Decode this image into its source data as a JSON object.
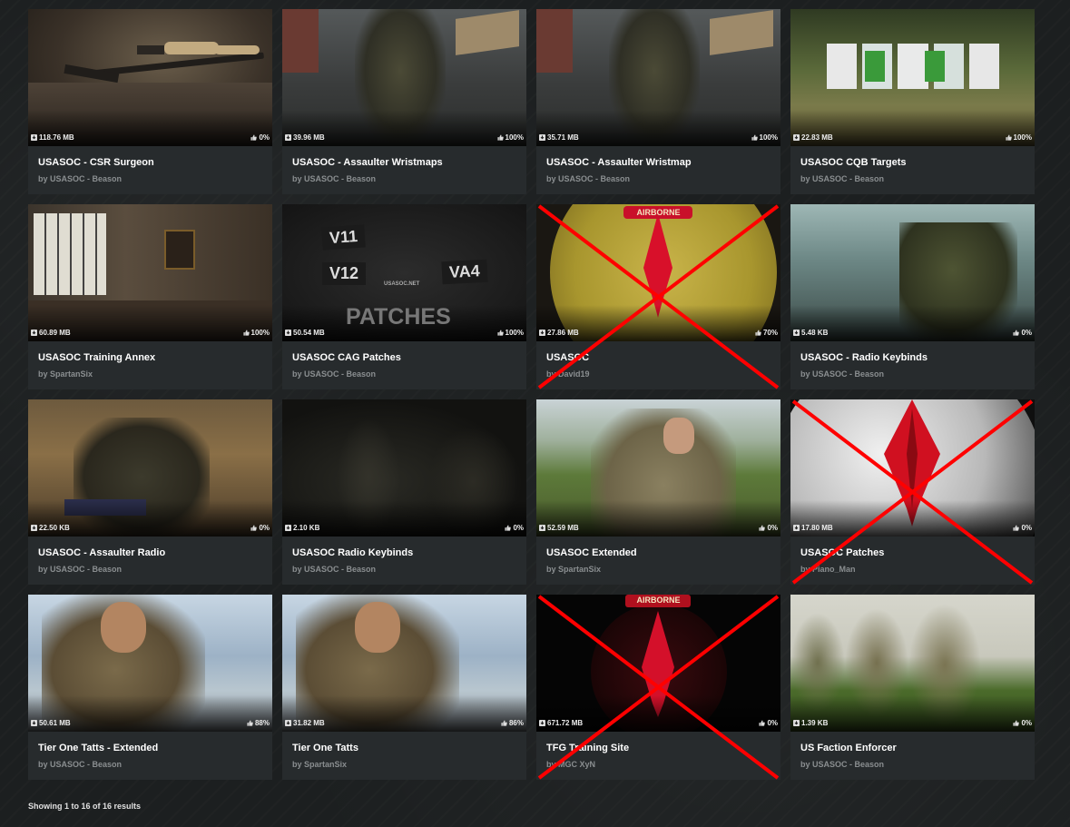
{
  "items": [
    {
      "title": "USASOC - CSR Surgeon",
      "author": "by USASOC - Beason",
      "size": "118.76 MB",
      "rating": "0%",
      "crossed": false,
      "scene": "rifle"
    },
    {
      "title": "USASOC - Assaulter Wristmaps",
      "author": "by USASOC - Beason",
      "size": "39.96 MB",
      "rating": "100%",
      "crossed": false,
      "scene": "hangar"
    },
    {
      "title": "USASOC - Assaulter Wristmap",
      "author": "by USASOC - Beason",
      "size": "35.71 MB",
      "rating": "100%",
      "crossed": false,
      "scene": "hangar"
    },
    {
      "title": "USASOC CQB Targets",
      "author": "by USASOC - Beason",
      "size": "22.83 MB",
      "rating": "100%",
      "crossed": false,
      "scene": "targets"
    },
    {
      "title": "USASOC Training Annex",
      "author": "by SpartanSix",
      "size": "60.89 MB",
      "rating": "100%",
      "crossed": false,
      "scene": "room"
    },
    {
      "title": "USASOC CAG Patches",
      "author": "by USASOC - Beason",
      "size": "50.54 MB",
      "rating": "100%",
      "crossed": false,
      "scene": "patches"
    },
    {
      "title": "USASOC",
      "author": "by David19",
      "size": "27.86 MB",
      "rating": "70%",
      "crossed": true,
      "scene": "emblem"
    },
    {
      "title": "USASOC - Radio Keybinds",
      "author": "by USASOC - Beason",
      "size": "5.48 KB",
      "rating": "0%",
      "crossed": false,
      "scene": "radio"
    },
    {
      "title": "USASOC - Assaulter Radio",
      "author": "by USASOC - Beason",
      "size": "22.50 KB",
      "rating": "0%",
      "crossed": false,
      "scene": "field"
    },
    {
      "title": "USASOC Radio Keybinds",
      "author": "by USASOC - Beason",
      "size": "2.10 KB",
      "rating": "0%",
      "crossed": false,
      "scene": "dark"
    },
    {
      "title": "USASOC Extended",
      "author": "by SpartanSix",
      "size": "52.59 MB",
      "rating": "0%",
      "crossed": false,
      "scene": "soldier"
    },
    {
      "title": "USASOC Patches",
      "author": "by Piano_Man",
      "size": "17.80 MB",
      "rating": "0%",
      "crossed": true,
      "scene": "globe"
    },
    {
      "title": "Tier One Tatts - Extended",
      "author": "by USASOC - Beason",
      "size": "50.61 MB",
      "rating": "88%",
      "crossed": false,
      "scene": "sky"
    },
    {
      "title": "Tier One Tatts",
      "author": "by SpartanSix",
      "size": "31.82 MB",
      "rating": "86%",
      "crossed": false,
      "scene": "sky"
    },
    {
      "title": "TFG Training Site",
      "author": "by MGC XyN",
      "size": "671.72 MB",
      "rating": "0%",
      "crossed": true,
      "scene": "airborne"
    },
    {
      "title": "US Faction Enforcer",
      "author": "by USASOC - Beason",
      "size": "1.39 KB",
      "rating": "0%",
      "crossed": false,
      "scene": "squad"
    }
  ],
  "patch_labels": {
    "v11": "V11",
    "v12": "V12",
    "va4": "VA4",
    "site": "USASOC.NET",
    "patches": "PATCHES"
  },
  "airborne_label": "AIRBORNE",
  "status": "Showing 1 to 16 of 16 results",
  "colors": {
    "background": "#1c1f20",
    "card": "#272b2d",
    "title": "#ffffff",
    "author": "#8a8e90",
    "cross": "#ff0000"
  }
}
